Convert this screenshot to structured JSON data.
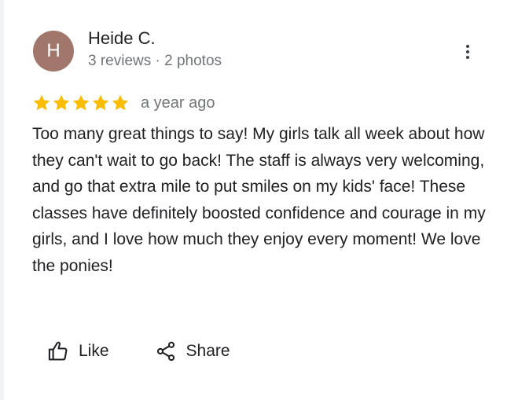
{
  "reviewer": {
    "initial": "H",
    "name": "Heide C.",
    "meta": "3 reviews · 2 photos",
    "avatar_color": "#a0776a"
  },
  "more_menu": {
    "icon": "more-vert-icon"
  },
  "rating": {
    "stars": 5,
    "max": 5,
    "star_color": "#fbbc04",
    "date": "a year ago"
  },
  "review": {
    "text": "Too many great things to say! My girls talk all week about how they can't wait to go back! The staff is always very welcoming, and go that extra mile to put smiles on my kids' face! These classes have definitely boosted confidence and courage in my girls, and I love how much they enjoy every moment! We love the ponies!"
  },
  "actions": {
    "like_label": "Like",
    "like_icon": "thumb-up-icon",
    "share_label": "Share",
    "share_icon": "share-icon"
  }
}
